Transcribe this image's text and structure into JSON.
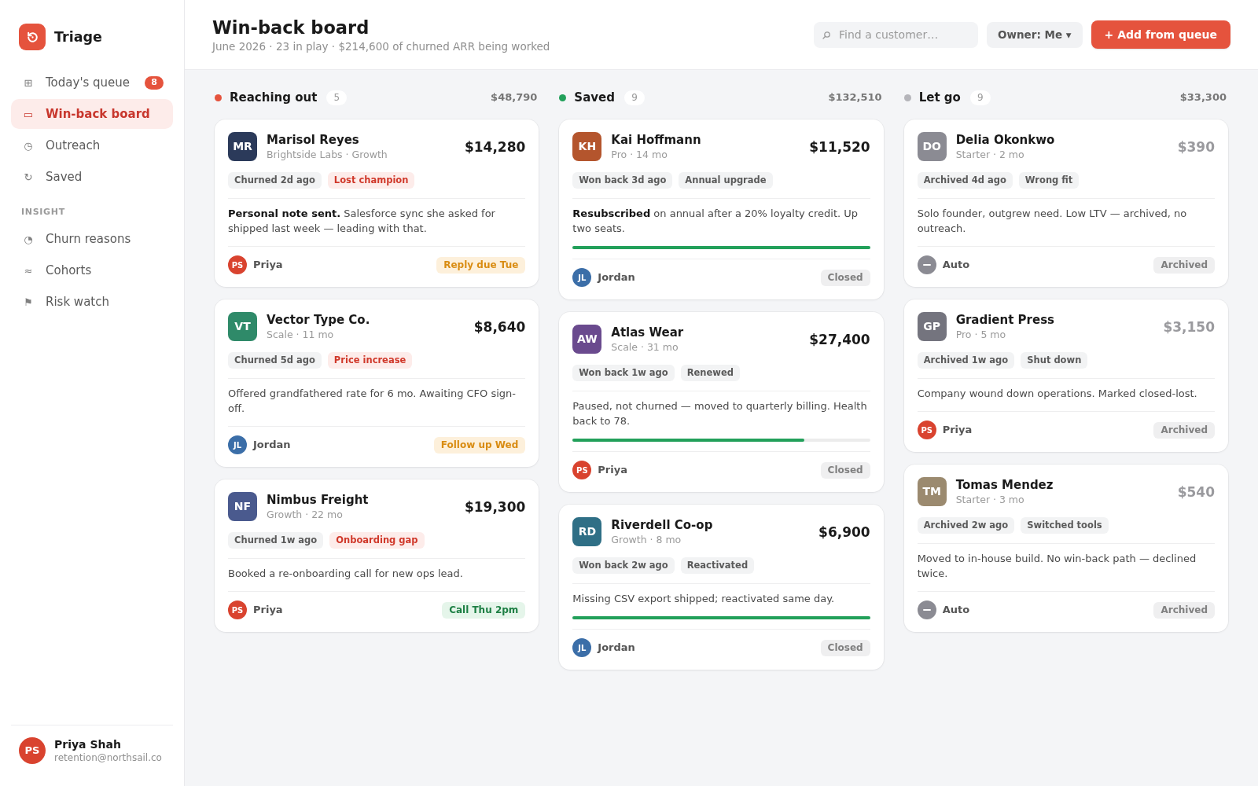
{
  "sidebar": {
    "brand": {
      "name": "Triage"
    },
    "nav_groups": [
      {
        "items": [
          {
            "icon": "⊞",
            "label": "Today's queue",
            "badge": "8",
            "selected": false
          },
          {
            "icon": "▭",
            "label": "Win-back board",
            "selected": true
          },
          {
            "icon": "◷",
            "label": "Outreach",
            "selected": false
          },
          {
            "icon": "↻",
            "label": "Saved",
            "selected": false
          }
        ]
      },
      {
        "heading": "INSIGHT",
        "items": [
          {
            "icon": "◔",
            "label": "Churn reasons",
            "selected": false
          },
          {
            "icon": "≈",
            "label": "Cohorts",
            "selected": false
          },
          {
            "icon": "⚑",
            "label": "Risk watch",
            "selected": false
          }
        ]
      }
    ],
    "user": {
      "initials": "PS",
      "name": "Priya Shah",
      "email": "retention@northsail.co"
    }
  },
  "header": {
    "title": "Win-back board",
    "subtitle": "June 2026 · 23 in play · $214,600 of churned ARR being worked",
    "search": {
      "placeholder": "Find a customer…"
    },
    "owner_filter": "Owner: Me ▾",
    "add_button": "+ Add from queue"
  },
  "columns": [
    {
      "title": "Reaching out",
      "count": "5",
      "total": "$48,790",
      "color": "#e5533d",
      "muted": false,
      "cards": [
        {
          "initials": "MR",
          "color": "#2b3a5a",
          "name": "Marisol Reyes",
          "meta": "Brightside Labs · Growth",
          "amount": "$14,280",
          "tags": [
            {
              "label": "Churned 2d ago",
              "kind": "neutral"
            },
            {
              "label": "Lost champion",
              "kind": "alert"
            }
          ],
          "note": "**Personal note sent.** Salesforce sync she asked for shipped last week — leading with that.",
          "owner": {
            "kind": "person",
            "initials": "PS",
            "name": "Priya",
            "color": "#d9432f"
          },
          "badge": {
            "label": "Reply due Tue",
            "kind": "warning"
          }
        },
        {
          "initials": "VT",
          "color": "#2f8a69",
          "name": "Vector Type Co.",
          "meta": "Scale · 11 mo",
          "amount": "$8,640",
          "tags": [
            {
              "label": "Churned 5d ago",
              "kind": "neutral"
            },
            {
              "label": "Price increase",
              "kind": "alert"
            }
          ],
          "note": "Offered grandfathered rate for 6 mo. Awaiting CFO sign-off.",
          "owner": {
            "kind": "person",
            "initials": "JL",
            "name": "Jordan",
            "color": "#3b6ea8"
          },
          "badge": {
            "label": "Follow up Wed",
            "kind": "warning"
          }
        },
        {
          "initials": "NF",
          "color": "#4a5a8e",
          "name": "Nimbus Freight",
          "meta": "Growth · 22 mo",
          "amount": "$19,300",
          "tags": [
            {
              "label": "Churned 1w ago",
              "kind": "neutral"
            },
            {
              "label": "Onboarding gap",
              "kind": "alert"
            }
          ],
          "note": "Booked a re-onboarding call for new ops lead.",
          "owner": {
            "kind": "person",
            "initials": "PS",
            "name": "Priya",
            "color": "#d9432f"
          },
          "badge": {
            "label": "Call Thu 2pm",
            "kind": "success"
          }
        }
      ]
    },
    {
      "title": "Saved",
      "count": "9",
      "total": "$132,510",
      "color": "#22a05a",
      "muted": false,
      "cards": [
        {
          "initials": "KH",
          "color": "#b4552d",
          "name": "Kai Hoffmann",
          "meta": "Pro · 14 mo",
          "amount": "$11,520",
          "tags": [
            {
              "label": "Won back 3d ago",
              "kind": "neutral"
            },
            {
              "label": "Annual upgrade",
              "kind": "neutral"
            }
          ],
          "note": "**Resubscribed** on annual after a 20% loyalty credit. Up two seats.",
          "level": 1,
          "owner": {
            "kind": "person",
            "initials": "JL",
            "name": "Jordan",
            "color": "#3b6ea8"
          },
          "badge": {
            "label": "Closed",
            "kind": "neutral"
          }
        },
        {
          "initials": "AW",
          "color": "#6a4a8e",
          "name": "Atlas Wear",
          "meta": "Scale · 31 mo",
          "amount": "$27,400",
          "tags": [
            {
              "label": "Won back 1w ago",
              "kind": "neutral"
            },
            {
              "label": "Renewed",
              "kind": "neutral"
            }
          ],
          "note": "Paused, not churned — moved to quarterly billing. Health back to 78.",
          "level": 0.78,
          "owner": {
            "kind": "person",
            "initials": "PS",
            "name": "Priya",
            "color": "#d9432f"
          },
          "badge": {
            "label": "Closed",
            "kind": "neutral"
          }
        },
        {
          "initials": "RD",
          "color": "#2f6f86",
          "name": "Riverdell Co-op",
          "meta": "Growth · 8 mo",
          "amount": "$6,900",
          "tags": [
            {
              "label": "Won back 2w ago",
              "kind": "neutral"
            },
            {
              "label": "Reactivated",
              "kind": "neutral"
            }
          ],
          "note": "Missing CSV export shipped; reactivated same day.",
          "level": 1,
          "owner": {
            "kind": "person",
            "initials": "JL",
            "name": "Jordan",
            "color": "#3b6ea8"
          },
          "badge": {
            "label": "Closed",
            "kind": "neutral"
          }
        }
      ]
    },
    {
      "title": "Let go",
      "count": "9",
      "total": "$33,300",
      "color": "#b5b5ba",
      "muted": true,
      "cards": [
        {
          "initials": "DO",
          "color": "#8b8b93",
          "name": "Delia Okonkwo",
          "meta": "Starter · 2 mo",
          "amount": "$390",
          "tags": [
            {
              "label": "Archived 4d ago",
              "kind": "neutral"
            },
            {
              "label": "Wrong fit",
              "kind": "neutral"
            }
          ],
          "note": "Solo founder, outgrew need. Low LTV — archived, no outreach.",
          "owner": {
            "kind": "auto",
            "name": "Auto"
          },
          "badge": {
            "label": "Archived",
            "kind": "neutral"
          }
        },
        {
          "initials": "GP",
          "color": "#74747e",
          "name": "Gradient Press",
          "meta": "Pro · 5 mo",
          "amount": "$3,150",
          "tags": [
            {
              "label": "Archived 1w ago",
              "kind": "neutral"
            },
            {
              "label": "Shut down",
              "kind": "neutral"
            }
          ],
          "note": "Company wound down operations. Marked closed-lost.",
          "owner": {
            "kind": "person",
            "initials": "PS",
            "name": "Priya",
            "color": "#d9432f"
          },
          "badge": {
            "label": "Archived",
            "kind": "neutral"
          }
        },
        {
          "initials": "TM",
          "color": "#9b8a6f",
          "name": "Tomas Mendez",
          "meta": "Starter · 3 mo",
          "amount": "$540",
          "tags": [
            {
              "label": "Archived 2w ago",
              "kind": "neutral"
            },
            {
              "label": "Switched tools",
              "kind": "neutral"
            }
          ],
          "note": "Moved to in-house build. No win-back path — declined twice.",
          "owner": {
            "kind": "auto",
            "name": "Auto"
          },
          "badge": {
            "label": "Archived",
            "kind": "neutral"
          }
        }
      ]
    }
  ]
}
